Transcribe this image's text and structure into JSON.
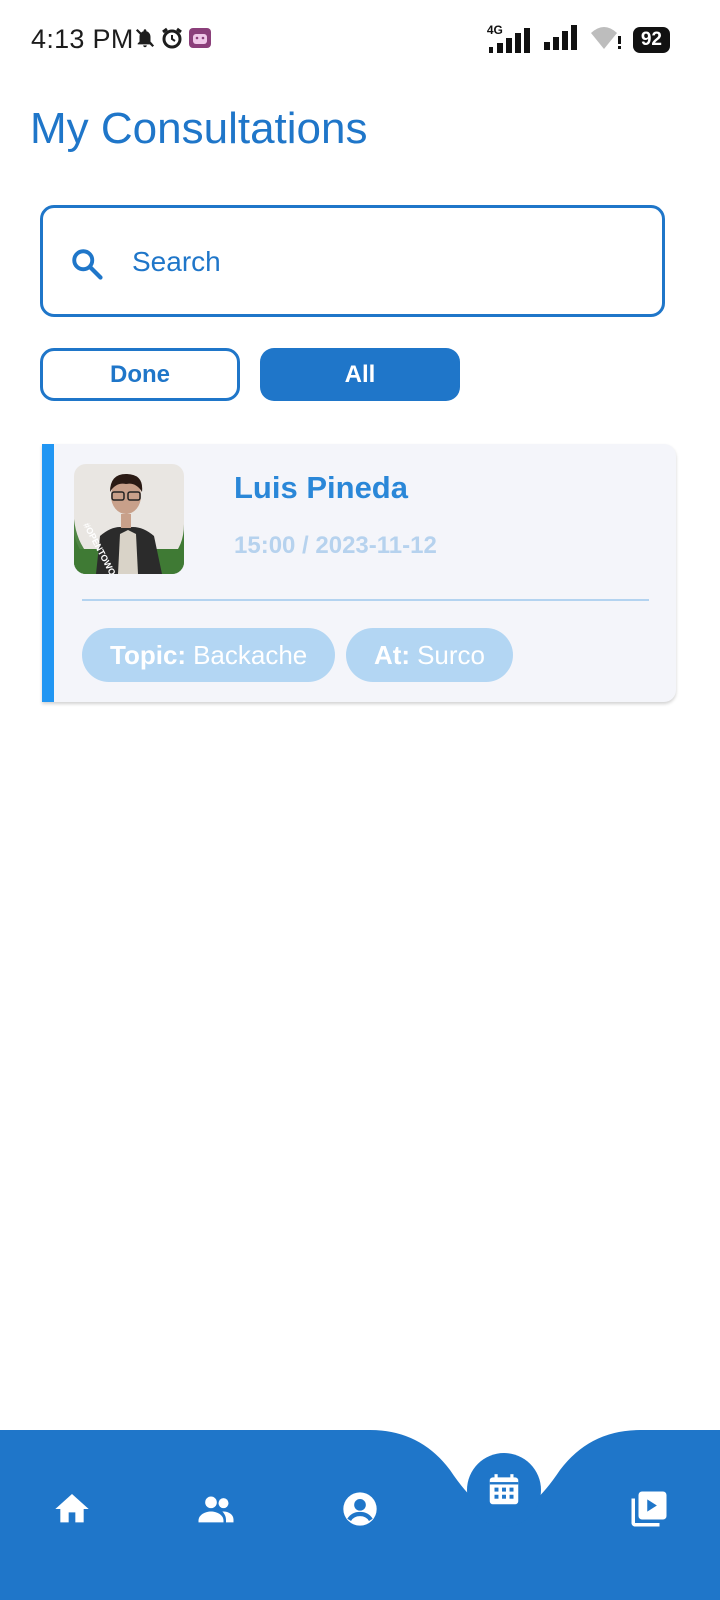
{
  "status_bar": {
    "time": "4:13 PM",
    "network": "4G",
    "battery": "92",
    "icons": [
      "bell-off-icon",
      "alarm-icon",
      "android-app-icon",
      "signal-icon",
      "signal-icon",
      "wifi-icon"
    ]
  },
  "page": {
    "title": "My Consultations"
  },
  "search": {
    "placeholder": "Search",
    "value": ""
  },
  "filters": [
    {
      "label": "Done",
      "active": false
    },
    {
      "label": "All",
      "active": true
    }
  ],
  "consultations": [
    {
      "doctor_name": "Luis Pineda",
      "datetime": "15:00 / 2023-11-12",
      "avatar_badge": "#OPENTOWORK",
      "topic_label": "Topic:",
      "topic": "Backache",
      "place_label": "At:",
      "place": "Surco"
    }
  ],
  "bottom_nav": {
    "items": [
      "home-icon",
      "people-icon",
      "account-icon",
      "calendar-icon",
      "video-library-icon"
    ],
    "active": "calendar-icon"
  },
  "colors": {
    "primary": "#1f76c9",
    "accent_bar": "#2196f3",
    "card_bg": "#f4f5fa",
    "chip_bg": "#b3d6f3"
  }
}
